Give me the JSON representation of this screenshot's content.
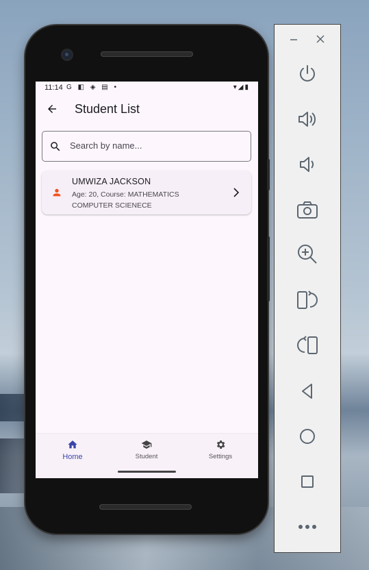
{
  "status_bar": {
    "time": "11:14",
    "left_icons": "G ◧ ◈ ▤ •",
    "right_icons": "▾◢▮"
  },
  "app_bar": {
    "title": "Student List"
  },
  "search": {
    "placeholder": "Search by name..."
  },
  "students": [
    {
      "name": "UMWIZA JACKSON",
      "details_line1": "Age: 20, Course: MATHEMATICS",
      "details_line2": "COMPUTER SCIENECE"
    }
  ],
  "bottom_nav": {
    "items": [
      {
        "label": "Home",
        "icon": "home-icon",
        "active": true
      },
      {
        "label": "Student",
        "icon": "graduation-cap-icon",
        "active": false
      },
      {
        "label": "Settings",
        "icon": "gear-icon",
        "active": false
      }
    ]
  },
  "colors": {
    "accent": "#3b46a8",
    "person_icon": "#f4511e",
    "screen_bg": "#fdf7fd",
    "card_bg": "#f6eff7"
  },
  "emulator_panel": {
    "window_controls": [
      "minimize-icon",
      "close-icon"
    ],
    "tools": [
      "power-icon",
      "volume-up-icon",
      "volume-down-icon",
      "camera-icon",
      "zoom-icon",
      "rotate-left-icon",
      "rotate-right-icon",
      "back-icon",
      "home-circle-icon",
      "overview-icon",
      "more-icon"
    ]
  }
}
